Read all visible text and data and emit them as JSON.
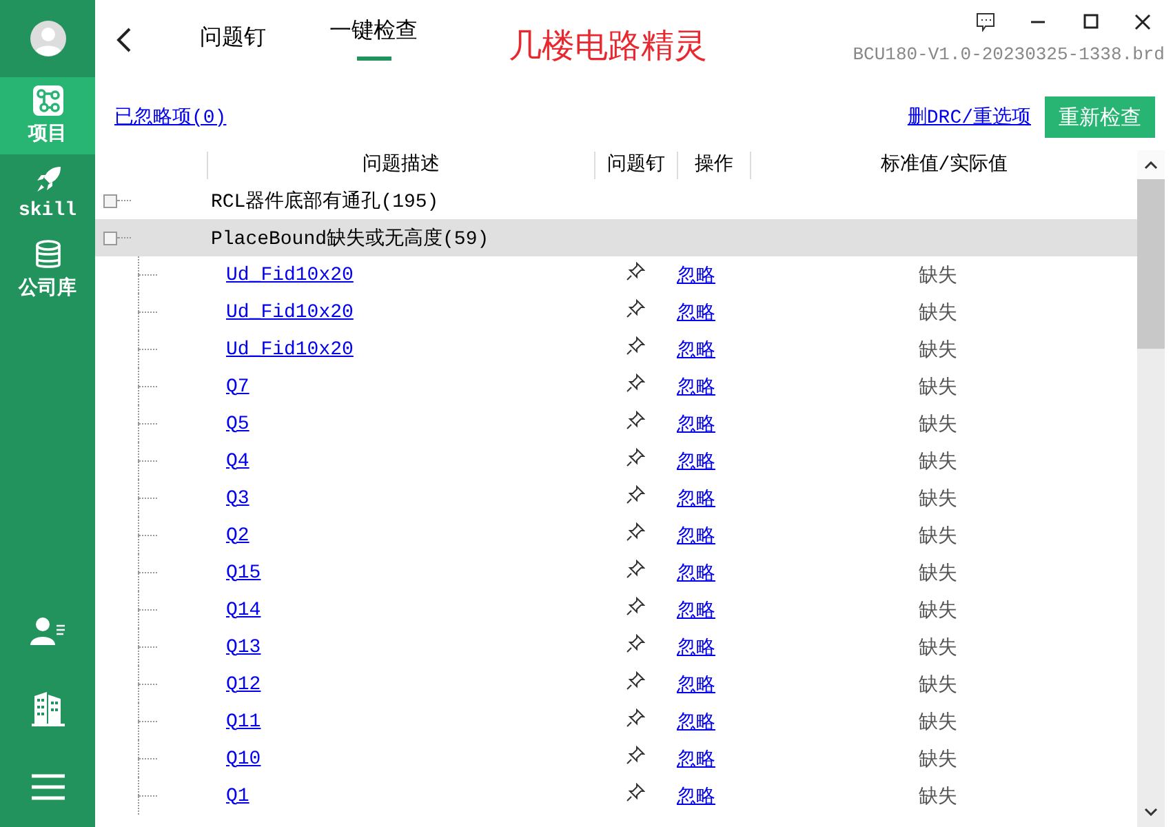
{
  "sidebar": {
    "items": [
      {
        "label": "项目",
        "selected": true
      },
      {
        "label": "skill",
        "selected": false
      },
      {
        "label": "公司库",
        "selected": false
      }
    ]
  },
  "tabs": [
    {
      "label": "问题钉",
      "selected": false
    },
    {
      "label": "一键检查",
      "selected": true
    }
  ],
  "app_title": "几楼电路精灵",
  "file_name": "BCU180-V1.0-20230325-1338.brd",
  "ignored_link": "已忽略项(0)",
  "reset_link": "删DRC/重选项",
  "recheck_button": "重新检查",
  "table": {
    "columns": [
      "问题描述",
      "问题钉",
      "操作",
      "标准值/实际值"
    ],
    "groups": [
      {
        "label": "RCL器件底部有通孔(195)",
        "selected": false
      },
      {
        "label": "PlaceBound缺失或无高度(59)",
        "selected": true,
        "children": [
          {
            "name": "Ud_Fid10x20",
            "action": "忽略",
            "value": "缺失"
          },
          {
            "name": "Ud_Fid10x20",
            "action": "忽略",
            "value": "缺失"
          },
          {
            "name": "Ud_Fid10x20",
            "action": "忽略",
            "value": "缺失"
          },
          {
            "name": "Q7",
            "action": "忽略",
            "value": "缺失"
          },
          {
            "name": "Q5",
            "action": "忽略",
            "value": "缺失"
          },
          {
            "name": "Q4",
            "action": "忽略",
            "value": "缺失"
          },
          {
            "name": "Q3",
            "action": "忽略",
            "value": "缺失"
          },
          {
            "name": "Q2",
            "action": "忽略",
            "value": "缺失"
          },
          {
            "name": "Q15",
            "action": "忽略",
            "value": "缺失"
          },
          {
            "name": "Q14",
            "action": "忽略",
            "value": "缺失"
          },
          {
            "name": "Q13",
            "action": "忽略",
            "value": "缺失"
          },
          {
            "name": "Q12",
            "action": "忽略",
            "value": "缺失"
          },
          {
            "name": "Q11",
            "action": "忽略",
            "value": "缺失"
          },
          {
            "name": "Q10",
            "action": "忽略",
            "value": "缺失"
          },
          {
            "name": "Q1",
            "action": "忽略",
            "value": "缺失"
          }
        ]
      }
    ]
  }
}
